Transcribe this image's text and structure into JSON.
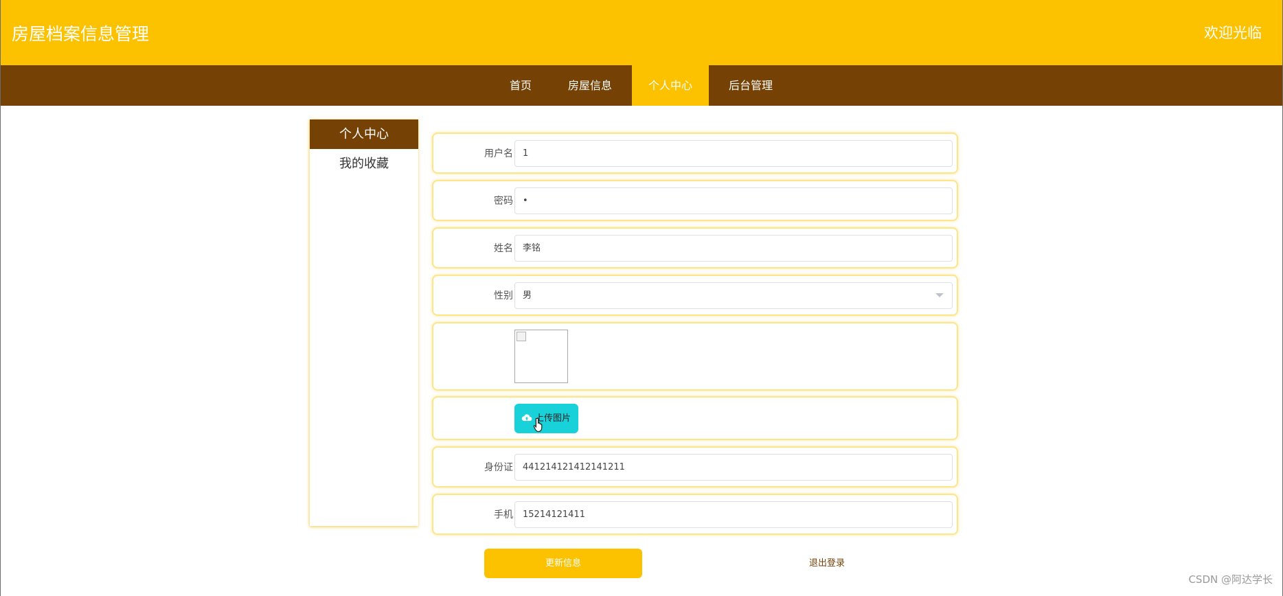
{
  "header": {
    "title": "房屋档案信息管理",
    "welcome": "欢迎光临"
  },
  "nav": {
    "items": [
      "首页",
      "房屋信息",
      "个人中心",
      "后台管理"
    ],
    "active": "个人中心"
  },
  "sidebar": {
    "items": [
      "个人中心",
      "我的收藏"
    ],
    "active": "个人中心"
  },
  "form": {
    "username_label": "用户名",
    "username_value": "1",
    "password_label": "密码",
    "password_value": "•",
    "name_label": "姓名",
    "name_value": "李铭",
    "gender_label": "性别",
    "gender_value": "男",
    "upload_label": "上传图片",
    "idcard_label": "身份证",
    "idcard_value": "441214121412141211",
    "phone_label": "手机",
    "phone_value": "15214121411"
  },
  "actions": {
    "update_label": "更新信息",
    "logout_label": "退出登录"
  },
  "watermark": "CSDN @阿达学长",
  "icons": {
    "upload": "cloud-upload-icon",
    "select": "chevron-down-icon",
    "cursor": "hand-pointer-icon"
  },
  "colors": {
    "header": "#fcc200",
    "nav": "#754104",
    "upload_button": "#19d1d8",
    "row_border": "#fde58a"
  }
}
